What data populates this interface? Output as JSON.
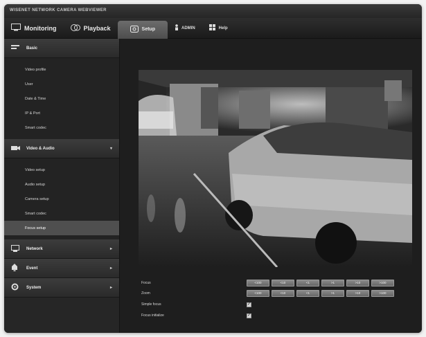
{
  "window": {
    "title": "WISENET NETWORK CAMERA WEBVIEWER"
  },
  "topnav": {
    "monitoring": "Monitoring",
    "playback": "Playback",
    "setup": "Setup",
    "user": "ADMIN",
    "help": "Help"
  },
  "sidebar": {
    "basic": {
      "label": "Basic",
      "items": [
        "Video profile",
        "User",
        "Date & Time",
        "IP & Port",
        "Smart codec"
      ]
    },
    "video_audio": {
      "label": "Video & Audio",
      "items": [
        "Video setup",
        "Audio setup",
        "Camera setup",
        "Smart codec",
        "Focus setup"
      ],
      "selected": "Focus setup"
    },
    "network": {
      "label": "Network"
    },
    "event": {
      "label": "Event"
    },
    "system": {
      "label": "System"
    }
  },
  "controls": {
    "focus": {
      "label": "Focus",
      "buttons": [
        "<100",
        "<10",
        "<1",
        ">1",
        ">10",
        ">100"
      ]
    },
    "zoom": {
      "label": "Zoom",
      "buttons": [
        "<100",
        "<10",
        "<1",
        ">1",
        ">10",
        ">100"
      ]
    },
    "simple_focus": {
      "label": "Simple focus",
      "checked": true
    },
    "focus_initialize": {
      "label": "Focus initialize",
      "checked": true
    }
  },
  "colors": {
    "accent": "#5b5b5b",
    "background": "#1e1e1e",
    "sidebar": "#262626"
  },
  "icons": [
    "monitor-icon",
    "playback-icon",
    "setup-icon",
    "user-icon",
    "help-icon",
    "basic-icon",
    "camera-icon",
    "network-icon",
    "event-icon",
    "gear-icon"
  ]
}
